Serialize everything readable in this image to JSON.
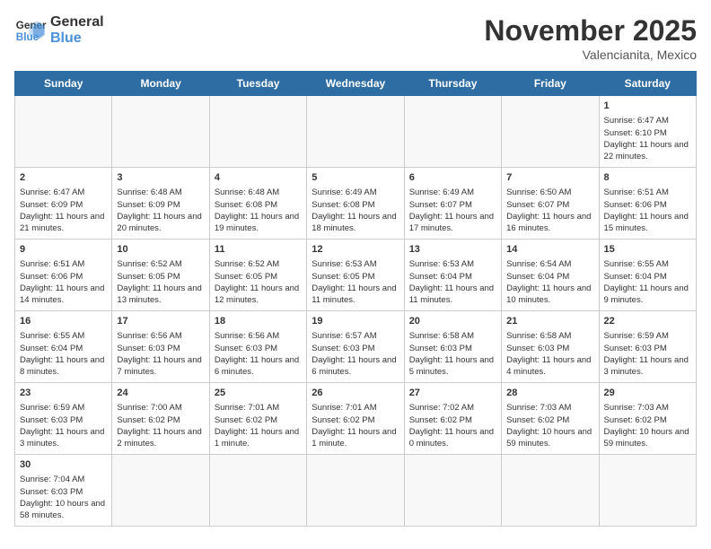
{
  "header": {
    "logo_general": "General",
    "logo_blue": "Blue",
    "title": "November 2025",
    "location": "Valencianita, Mexico"
  },
  "days_of_week": [
    "Sunday",
    "Monday",
    "Tuesday",
    "Wednesday",
    "Thursday",
    "Friday",
    "Saturday"
  ],
  "weeks": [
    [
      {
        "day": "",
        "empty": true
      },
      {
        "day": "",
        "empty": true
      },
      {
        "day": "",
        "empty": true
      },
      {
        "day": "",
        "empty": true
      },
      {
        "day": "",
        "empty": true
      },
      {
        "day": "",
        "empty": true
      },
      {
        "day": "1",
        "sunrise": "Sunrise: 6:47 AM",
        "sunset": "Sunset: 6:10 PM",
        "daylight": "Daylight: 11 hours and 22 minutes."
      }
    ],
    [
      {
        "day": "2",
        "sunrise": "Sunrise: 6:47 AM",
        "sunset": "Sunset: 6:09 PM",
        "daylight": "Daylight: 11 hours and 21 minutes."
      },
      {
        "day": "3",
        "sunrise": "Sunrise: 6:48 AM",
        "sunset": "Sunset: 6:09 PM",
        "daylight": "Daylight: 11 hours and 20 minutes."
      },
      {
        "day": "4",
        "sunrise": "Sunrise: 6:48 AM",
        "sunset": "Sunset: 6:08 PM",
        "daylight": "Daylight: 11 hours and 19 minutes."
      },
      {
        "day": "5",
        "sunrise": "Sunrise: 6:49 AM",
        "sunset": "Sunset: 6:08 PM",
        "daylight": "Daylight: 11 hours and 18 minutes."
      },
      {
        "day": "6",
        "sunrise": "Sunrise: 6:49 AM",
        "sunset": "Sunset: 6:07 PM",
        "daylight": "Daylight: 11 hours and 17 minutes."
      },
      {
        "day": "7",
        "sunrise": "Sunrise: 6:50 AM",
        "sunset": "Sunset: 6:07 PM",
        "daylight": "Daylight: 11 hours and 16 minutes."
      },
      {
        "day": "8",
        "sunrise": "Sunrise: 6:51 AM",
        "sunset": "Sunset: 6:06 PM",
        "daylight": "Daylight: 11 hours and 15 minutes."
      }
    ],
    [
      {
        "day": "9",
        "sunrise": "Sunrise: 6:51 AM",
        "sunset": "Sunset: 6:06 PM",
        "daylight": "Daylight: 11 hours and 14 minutes."
      },
      {
        "day": "10",
        "sunrise": "Sunrise: 6:52 AM",
        "sunset": "Sunset: 6:05 PM",
        "daylight": "Daylight: 11 hours and 13 minutes."
      },
      {
        "day": "11",
        "sunrise": "Sunrise: 6:52 AM",
        "sunset": "Sunset: 6:05 PM",
        "daylight": "Daylight: 11 hours and 12 minutes."
      },
      {
        "day": "12",
        "sunrise": "Sunrise: 6:53 AM",
        "sunset": "Sunset: 6:05 PM",
        "daylight": "Daylight: 11 hours and 11 minutes."
      },
      {
        "day": "13",
        "sunrise": "Sunrise: 6:53 AM",
        "sunset": "Sunset: 6:04 PM",
        "daylight": "Daylight: 11 hours and 11 minutes."
      },
      {
        "day": "14",
        "sunrise": "Sunrise: 6:54 AM",
        "sunset": "Sunset: 6:04 PM",
        "daylight": "Daylight: 11 hours and 10 minutes."
      },
      {
        "day": "15",
        "sunrise": "Sunrise: 6:55 AM",
        "sunset": "Sunset: 6:04 PM",
        "daylight": "Daylight: 11 hours and 9 minutes."
      }
    ],
    [
      {
        "day": "16",
        "sunrise": "Sunrise: 6:55 AM",
        "sunset": "Sunset: 6:04 PM",
        "daylight": "Daylight: 11 hours and 8 minutes."
      },
      {
        "day": "17",
        "sunrise": "Sunrise: 6:56 AM",
        "sunset": "Sunset: 6:03 PM",
        "daylight": "Daylight: 11 hours and 7 minutes."
      },
      {
        "day": "18",
        "sunrise": "Sunrise: 6:56 AM",
        "sunset": "Sunset: 6:03 PM",
        "daylight": "Daylight: 11 hours and 6 minutes."
      },
      {
        "day": "19",
        "sunrise": "Sunrise: 6:57 AM",
        "sunset": "Sunset: 6:03 PM",
        "daylight": "Daylight: 11 hours and 6 minutes."
      },
      {
        "day": "20",
        "sunrise": "Sunrise: 6:58 AM",
        "sunset": "Sunset: 6:03 PM",
        "daylight": "Daylight: 11 hours and 5 minutes."
      },
      {
        "day": "21",
        "sunrise": "Sunrise: 6:58 AM",
        "sunset": "Sunset: 6:03 PM",
        "daylight": "Daylight: 11 hours and 4 minutes."
      },
      {
        "day": "22",
        "sunrise": "Sunrise: 6:59 AM",
        "sunset": "Sunset: 6:03 PM",
        "daylight": "Daylight: 11 hours and 3 minutes."
      }
    ],
    [
      {
        "day": "23",
        "sunrise": "Sunrise: 6:59 AM",
        "sunset": "Sunset: 6:03 PM",
        "daylight": "Daylight: 11 hours and 3 minutes."
      },
      {
        "day": "24",
        "sunrise": "Sunrise: 7:00 AM",
        "sunset": "Sunset: 6:02 PM",
        "daylight": "Daylight: 11 hours and 2 minutes."
      },
      {
        "day": "25",
        "sunrise": "Sunrise: 7:01 AM",
        "sunset": "Sunset: 6:02 PM",
        "daylight": "Daylight: 11 hours and 1 minute."
      },
      {
        "day": "26",
        "sunrise": "Sunrise: 7:01 AM",
        "sunset": "Sunset: 6:02 PM",
        "daylight": "Daylight: 11 hours and 1 minute."
      },
      {
        "day": "27",
        "sunrise": "Sunrise: 7:02 AM",
        "sunset": "Sunset: 6:02 PM",
        "daylight": "Daylight: 11 hours and 0 minutes."
      },
      {
        "day": "28",
        "sunrise": "Sunrise: 7:03 AM",
        "sunset": "Sunset: 6:02 PM",
        "daylight": "Daylight: 10 hours and 59 minutes."
      },
      {
        "day": "29",
        "sunrise": "Sunrise: 7:03 AM",
        "sunset": "Sunset: 6:02 PM",
        "daylight": "Daylight: 10 hours and 59 minutes."
      }
    ],
    [
      {
        "day": "30",
        "sunrise": "Sunrise: 7:04 AM",
        "sunset": "Sunset: 6:03 PM",
        "daylight": "Daylight: 10 hours and 58 minutes."
      },
      {
        "day": "",
        "empty": true
      },
      {
        "day": "",
        "empty": true
      },
      {
        "day": "",
        "empty": true
      },
      {
        "day": "",
        "empty": true
      },
      {
        "day": "",
        "empty": true
      },
      {
        "day": "",
        "empty": true
      }
    ]
  ]
}
